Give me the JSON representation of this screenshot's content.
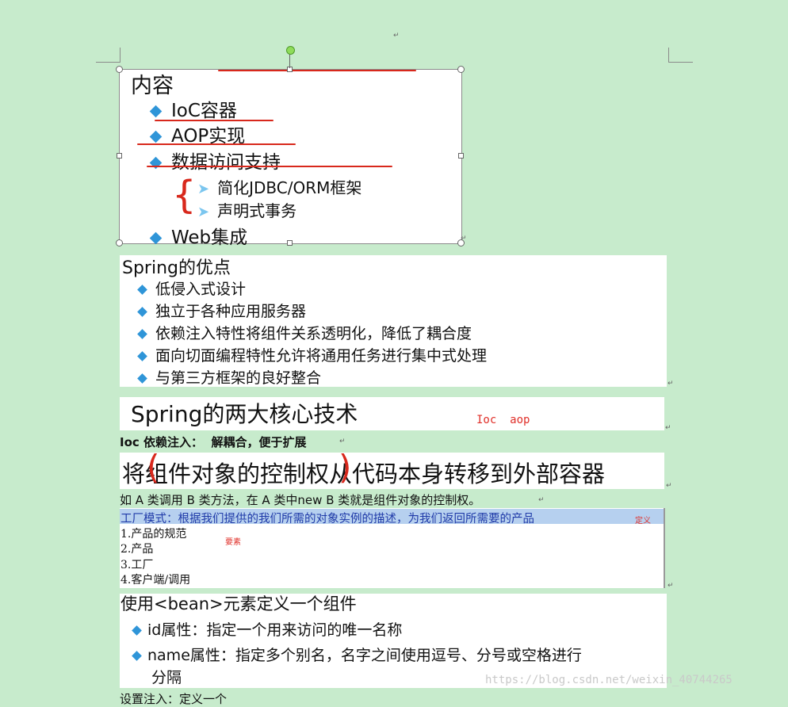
{
  "doc": {
    "pilcrow": "↵",
    "image1": {
      "title": "内容",
      "items": [
        {
          "label": "IoC容器"
        },
        {
          "label": "AOP实现"
        },
        {
          "label": "数据访问支持"
        },
        {
          "label": "Web集成"
        }
      ],
      "subitems": [
        {
          "label": "简化JDBC/ORM框架"
        },
        {
          "label": "声明式事务"
        }
      ]
    },
    "image2": {
      "title": "Spring的优点",
      "items": [
        {
          "label": "低侵入式设计"
        },
        {
          "label": "独立于各种应用服务器"
        },
        {
          "label": "依赖注入特性将组件关系透明化，降低了耦合度"
        },
        {
          "label": "面向切面编程特性允许将通用任务进行集中式处理"
        },
        {
          "label": "与第三方框架的良好整合"
        }
      ]
    },
    "image3": {
      "title": "Spring的两大核心技术",
      "annotation": "Ioc  aop"
    },
    "ioc_heading": "Ioc 依赖注入：  解耦合，便于扩展",
    "image4": {
      "text": "将组件对象的控制权从代码本身转移到外部容器"
    },
    "example_text": "如 A 类调用 B 类方法，在 A 类中new B 类就是组件对象的控制权。",
    "image5": {
      "highlight": "工厂模式：根据我们提供的我们所需的对象实例的描述，为我们返回所需要的产品",
      "note_define": "定义",
      "note_elements": "要素",
      "lines": [
        {
          "label": "1.产品的规范"
        },
        {
          "label": "2.产品"
        },
        {
          "label": "3.工厂"
        },
        {
          "label": "4.客户端/调用"
        }
      ]
    },
    "image6": {
      "title": "使用<bean>元素定义一个组件",
      "item1": "id属性：指定一个用来访问的唯一名称",
      "item2_line1": "name属性：指定多个别名，名字之间使用逗号、分号或空格进行",
      "item2_line2": "分隔"
    },
    "bottom_cut_text": "设置注入：定义一个",
    "watermark": "https://blog.csdn.net/weixin_40744265"
  }
}
